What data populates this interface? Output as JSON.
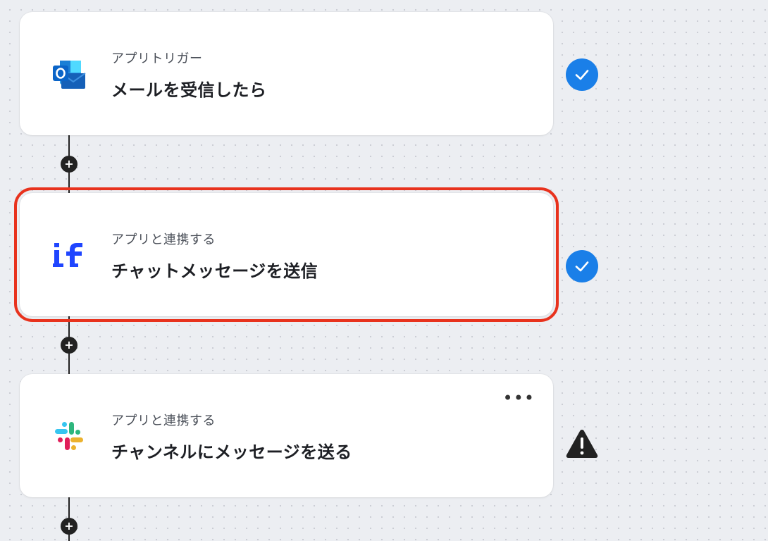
{
  "steps": [
    {
      "type_label": "アプリトリガー",
      "title": "メールを受信したら",
      "app_icon": "outlook-icon",
      "status": "completed",
      "status_icon": "check-circle-icon",
      "selected": false
    },
    {
      "type_label": "アプリと連携する",
      "title": "チャットメッセージを送信",
      "app_icon": "if-app-icon",
      "status": "completed",
      "status_icon": "check-circle-icon",
      "selected": true
    },
    {
      "type_label": "アプリと連携する",
      "title": "チャンネルにメッセージを送る",
      "app_icon": "slack-icon",
      "status": "warning",
      "status_icon": "warning-triangle-icon",
      "selected": false,
      "more_menu": "•••"
    }
  ],
  "add_step_symbol": "+",
  "colors": {
    "check_blue": "#1a7fe8",
    "selection_red": "#e8321d",
    "outlook_blue": "#0a64c8",
    "if_blue": "#1f45ff",
    "slack_red": "#e01e5a",
    "slack_blue": "#36c5f0",
    "slack_green": "#2eb67d",
    "slack_yellow": "#ecb22e"
  }
}
